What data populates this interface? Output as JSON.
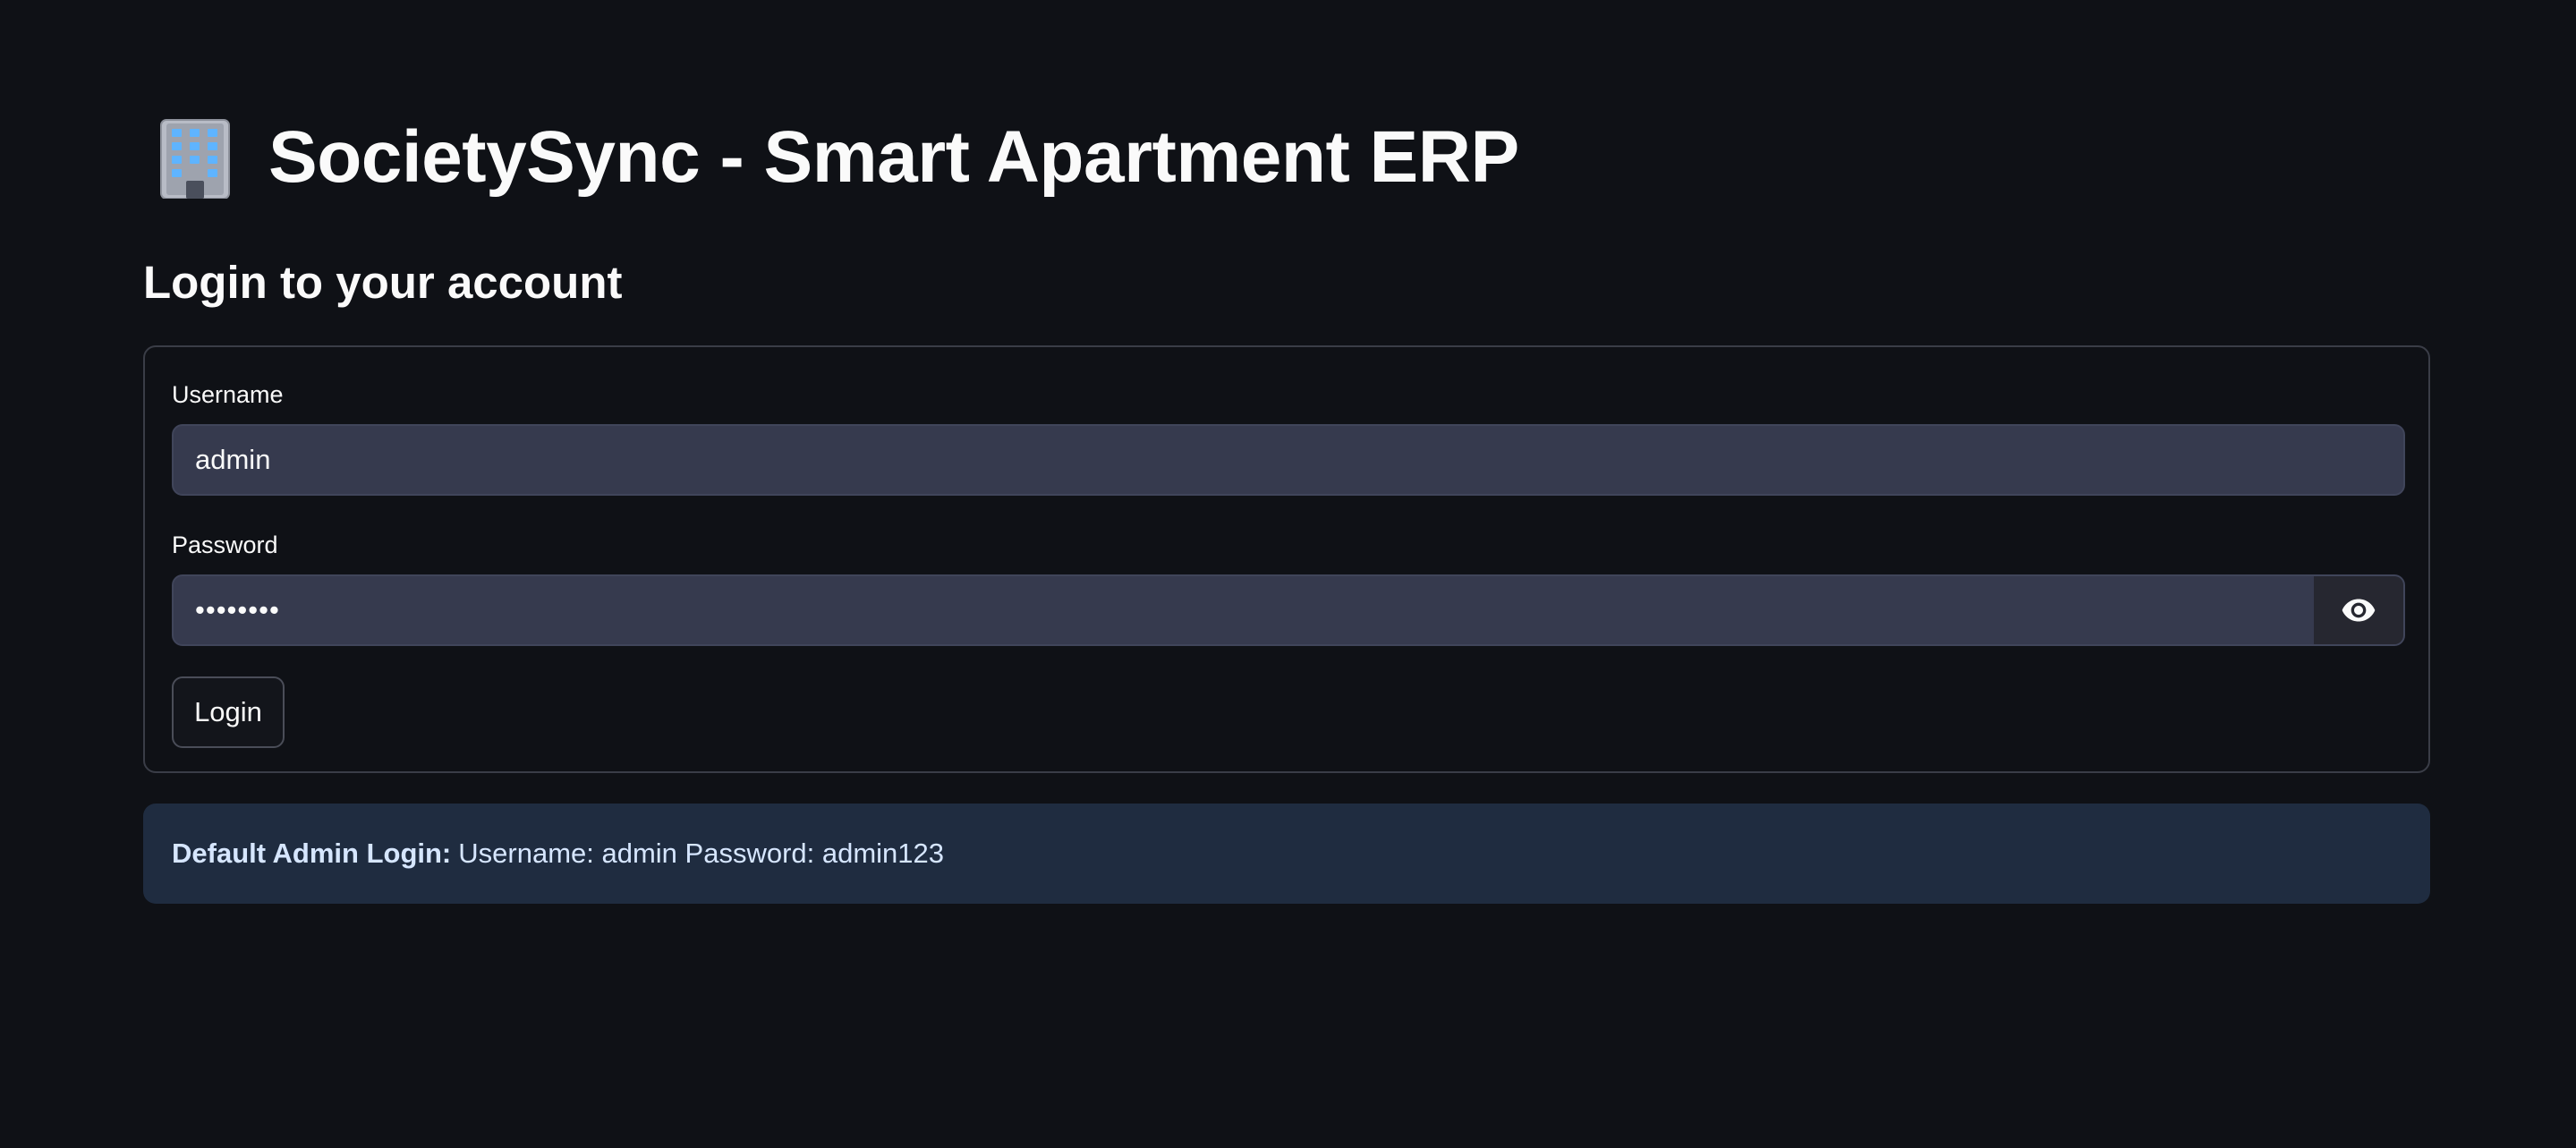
{
  "header": {
    "icon": "office-building-icon",
    "title": "SocietySync - Smart Apartment ERP"
  },
  "subtitle": "Login to your account",
  "form": {
    "username_label": "Username",
    "username_value": "admin",
    "password_label": "Password",
    "password_masked": "••••••••",
    "show_password_icon": "eye-icon",
    "login_label": "Login"
  },
  "info": {
    "bold": "Default Admin Login:",
    "text": "Username: admin Password: admin123"
  },
  "colors": {
    "background": "#0f1116",
    "input_background": "#363a4e",
    "info_background": "#1f2c40",
    "border": "#3a3d47"
  }
}
